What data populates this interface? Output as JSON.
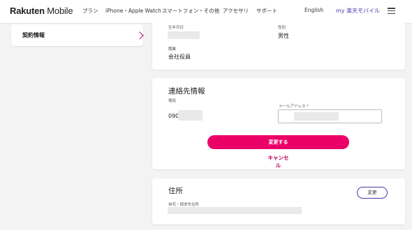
{
  "header": {
    "logo_brand": "Rakuten",
    "logo_product": " Mobile",
    "nav": [
      "プラン",
      "iPhone・Apple Watch",
      "スマートフォン・その他",
      "アクセサリ",
      "サポート"
    ],
    "language": "English",
    "my_page": "my 楽天モバイル"
  },
  "sidebar": {
    "contract_info": "契約情報"
  },
  "profile": {
    "birthdate_label": "生年月日",
    "gender_label": "性別",
    "gender_value": "男性",
    "occupation_label": "職業",
    "occupation_value": "会社役員"
  },
  "contact": {
    "title": "連絡先情報",
    "phone_label": "電話",
    "phone_prefix": "090",
    "email_label": "メールアドレス *",
    "submit_label": "変更する",
    "cancel_label": "キャンセル"
  },
  "address": {
    "title": "住所",
    "home_billing_label": "自宅・請求先住所",
    "change_label": "変更"
  },
  "colors": {
    "accent": "#eb0068",
    "link": "#bf0060",
    "brand_purple": "#4a3aa8"
  }
}
